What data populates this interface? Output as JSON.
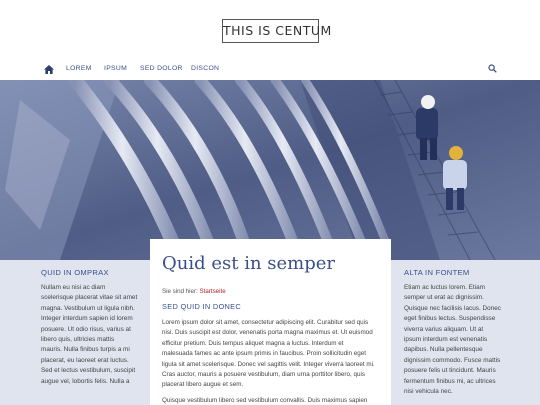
{
  "site": {
    "logo": "THIS IS CENTUM"
  },
  "nav": {
    "items": [
      "LOREM",
      "IPSUM",
      "SED DOLOR",
      "DISCON"
    ],
    "home_icon": "home-icon",
    "search_icon": "search-icon"
  },
  "colors": {
    "accent": "#3a4f8a",
    "link": "#b3252c",
    "sidebar_bg": "#dfe4ee"
  },
  "left": {
    "title": "QUID IN OMPRAX",
    "lines": [
      "Nullam eu nisi ac diam",
      "scelerisque placerat vitae sit amet",
      "magna. Vestibulum ut ligula nibh.",
      "Integer interdum sapien id lorem",
      "posuere. Ut odio risus, varius at",
      "libero quis, ultricies mattis",
      "mauris. Nulla finibus turpis a mi",
      "placerat, eu laoreet erat luctus.",
      "Sed et lectus vestibulum, suscipit",
      "augue vel, lobortis felis. Nulla a"
    ]
  },
  "main": {
    "title": "Quid est in semper",
    "breadcrumb_prefix": "Sie sind hier:",
    "breadcrumb_link": "Startseite",
    "subtitle": "SED QUID IN DONEC",
    "para1": [
      "Lorem ipsum dolor sit amet, consectetur adipiscing elit. Curabitur sed quis",
      "nisi. Duis suscipit est dolor, venenatis porta magna maximus et. Ut euismod",
      "efficitur pretium. Duis tempus aliquet magna a luctus. Interdum et",
      "malesuada fames ac ante ipsum primis in faucibus. Proin sollicitudin eget",
      "ligula sit amet scelerisque. Donec vel sagittis velit. Integer viverra laoreet mi.",
      "Cras auctor, mauris a posuere vestibulum, diam urna porttitor libero, quis",
      "placerat libero augue et sem."
    ],
    "para2": [
      "Quisque vestibulum libero sed vestibulum convallis. Duis maximus sapien"
    ]
  },
  "right": {
    "title": "ALTA IN FONTEM",
    "lines": [
      "Etiam ac luctus lorem. Etiam",
      "semper ut erat ac dignissim.",
      "Quisque nec facilisis lacus. Donec",
      "eget finibus lectus. Suspendisse",
      "viverra varius aliquam. Ut at",
      "ipsum interdum est venenatis",
      "dapibus. Nulla pellentesque",
      "dignissim commodo. Fusce mattis",
      "posuere felis ut tincidunt. Mauris",
      "fermentum finibus mi, ac ultrices",
      "nisi vehicula nec."
    ]
  }
}
